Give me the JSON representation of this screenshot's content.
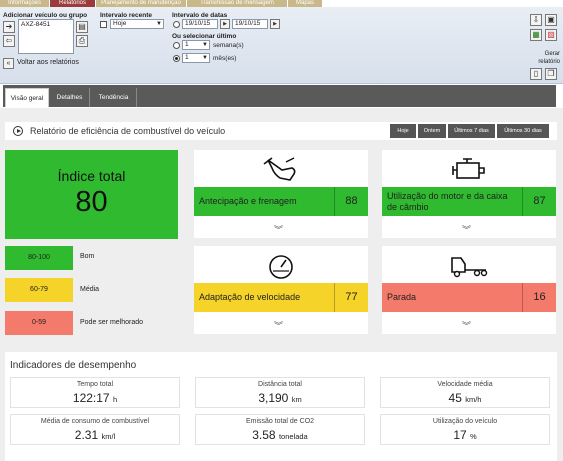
{
  "top_tabs": [
    "Informações",
    "Relatórios",
    "Planejamento de manutenção",
    "Transmissão de mensagem",
    "Mapas"
  ],
  "toolbar": {
    "add_vehicle_label": "Adicionar veículo ou grupo",
    "vehicle": "AXZ-8451",
    "recent_interval_label": "Intervalo recente",
    "recent_interval_value": "Hoje",
    "date_interval_label": "Intervalo de datas",
    "date_from": "19/10/15",
    "date_to": "19/10/15",
    "or_select_last": "Ou selecionar último",
    "weeks_count": "1",
    "weeks_unit": "semana(s)",
    "months_count": "1",
    "months_unit": "mês(es)",
    "back_label": "Voltar aos relatórios",
    "generate_label": "Gerar relatório"
  },
  "view_tabs": [
    "Visão geral",
    "Detalhes",
    "Tendência"
  ],
  "report": {
    "title": "Relatório de eficiência de combustível do veículo",
    "periods": [
      "Hoje",
      "Ontem",
      "Últimos 7 dias",
      "Últimos 30 dias"
    ],
    "total_label": "Índice total",
    "total_value": "80",
    "legend": [
      {
        "range": "80-100",
        "label": "Bom",
        "color": "#2fba2f"
      },
      {
        "range": "60-79",
        "label": "Média",
        "color": "#f5d328"
      },
      {
        "range": "0-59",
        "label": "Pode ser melhorado",
        "color": "#f47a6b"
      }
    ],
    "cards": [
      {
        "label": "Antecipação e frenagem",
        "value": "88",
        "color": "#2fba2f",
        "icon": "hand-brake-icon"
      },
      {
        "label": "Utilização do motor e da caixa de câmbio",
        "value": "87",
        "color": "#2fba2f",
        "icon": "engine-icon"
      },
      {
        "label": "Adaptação de velocidade",
        "value": "77",
        "color": "#f5d328",
        "icon": "speedometer-icon"
      },
      {
        "label": "Parada",
        "value": "16",
        "color": "#f47a6b",
        "icon": "truck-idle-icon"
      }
    ]
  },
  "performance": {
    "title": "Indicadores de desempenho",
    "items": [
      {
        "label": "Tempo total",
        "value": "122:17",
        "unit": "h"
      },
      {
        "label": "Distância total",
        "value": "3,190",
        "unit": "km"
      },
      {
        "label": "Velocidade média",
        "value": "45",
        "unit": "km/h"
      },
      {
        "label": "Média de consumo de combustível",
        "value": "2.31",
        "unit": "km/l"
      },
      {
        "label": "Emissão total de CO2",
        "value": "3.58",
        "unit": "tonelada"
      },
      {
        "label": "Utilização do veículo",
        "value": "17",
        "unit": "%"
      }
    ]
  }
}
